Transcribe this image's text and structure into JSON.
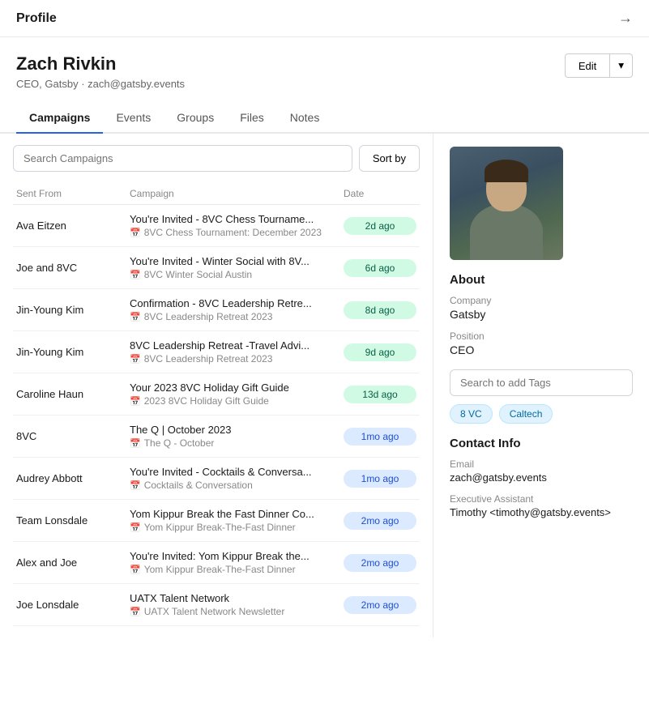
{
  "topBar": {
    "title": "Profile",
    "arrowIcon": "→"
  },
  "profileHeader": {
    "name": "Zach Rivkin",
    "subtitle": "CEO, Gatsby · zach@gatsby.events",
    "editLabel": "Edit",
    "caretIcon": "▾"
  },
  "tabs": [
    {
      "id": "campaigns",
      "label": "Campaigns",
      "active": true
    },
    {
      "id": "events",
      "label": "Events",
      "active": false
    },
    {
      "id": "groups",
      "label": "Groups",
      "active": false
    },
    {
      "id": "files",
      "label": "Files",
      "active": false
    },
    {
      "id": "notes",
      "label": "Notes",
      "active": false
    }
  ],
  "campaigns": {
    "searchPlaceholder": "Search Campaigns",
    "sortLabel": "Sort by",
    "tableHeaders": {
      "sentFrom": "Sent From",
      "campaign": "Campaign",
      "date": "Date"
    },
    "rows": [
      {
        "sentFrom": "Ava Eitzen",
        "campaignName": "You're Invited - 8VC Chess Tourname...",
        "campaignSub": "8VC Chess Tournament: December 2023",
        "date": "2d ago",
        "badgeType": "green"
      },
      {
        "sentFrom": "Joe and 8VC",
        "campaignName": "You're Invited - Winter Social with 8V...",
        "campaignSub": "8VC Winter Social Austin",
        "date": "6d ago",
        "badgeType": "green"
      },
      {
        "sentFrom": "Jin-Young Kim",
        "campaignName": "Confirmation - 8VC Leadership Retre...",
        "campaignSub": "8VC Leadership Retreat 2023",
        "date": "8d ago",
        "badgeType": "green"
      },
      {
        "sentFrom": "Jin-Young Kim",
        "campaignName": "8VC Leadership Retreat -Travel Advi...",
        "campaignSub": "8VC Leadership Retreat 2023",
        "date": "9d ago",
        "badgeType": "green"
      },
      {
        "sentFrom": "Caroline Haun",
        "campaignName": "Your 2023 8VC Holiday Gift Guide",
        "campaignSub": "2023 8VC Holiday Gift Guide",
        "date": "13d ago",
        "badgeType": "green"
      },
      {
        "sentFrom": "8VC",
        "campaignName": "The Q | October 2023",
        "campaignSub": "The Q - October",
        "date": "1mo ago",
        "badgeType": "blue"
      },
      {
        "sentFrom": "Audrey Abbott",
        "campaignName": "You're Invited - Cocktails & Conversa...",
        "campaignSub": "Cocktails & Conversation",
        "date": "1mo ago",
        "badgeType": "blue"
      },
      {
        "sentFrom": "Team Lonsdale",
        "campaignName": "Yom Kippur Break the Fast Dinner Co...",
        "campaignSub": "Yom Kippur Break-The-Fast Dinner",
        "date": "2mo ago",
        "badgeType": "blue"
      },
      {
        "sentFrom": "Alex and Joe",
        "campaignName": "You're Invited: Yom Kippur Break the...",
        "campaignSub": "Yom Kippur Break-The-Fast Dinner",
        "date": "2mo ago",
        "badgeType": "blue"
      },
      {
        "sentFrom": "Joe Lonsdale",
        "campaignName": "UATX Talent Network",
        "campaignSub": "UATX Talent Network Newsletter",
        "date": "2mo ago",
        "badgeType": "blue"
      }
    ]
  },
  "rightPanel": {
    "about": {
      "title": "About",
      "companyLabel": "Company",
      "companyValue": "Gatsby",
      "positionLabel": "Position",
      "positionValue": "CEO"
    },
    "tagsPlaceholder": "Search to add Tags",
    "tags": [
      "8 VC",
      "Caltech"
    ],
    "contactInfo": {
      "title": "Contact Info",
      "emailLabel": "Email",
      "emailValue": "zach@gatsby.events",
      "assistantLabel": "Executive Assistant",
      "assistantValue": "Timothy <timothy@gatsby.events>"
    }
  }
}
